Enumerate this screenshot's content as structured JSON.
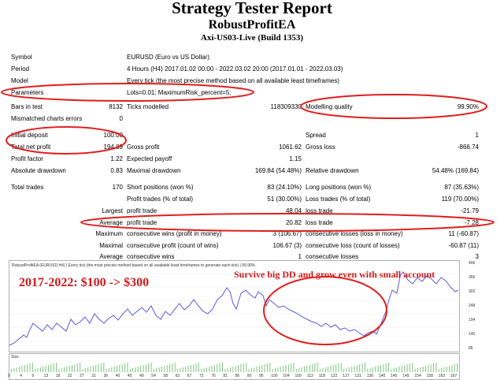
{
  "header": {
    "title": "Strategy Tester Report",
    "subtitle": "RobustProfitEA",
    "build": "Axi-US03-Live (Build 1353)"
  },
  "info": {
    "symbol_label": "Symbol",
    "symbol_value": "EURUSD (Euro vs US Dollar)",
    "period_label": "Period",
    "period_value": "4 Hours (H4) 2017.01.02 00:00 - 2022.03.02 20:00 (2017.01.01 - 2022.03.03)",
    "model_label": "Model",
    "model_value": "Every tick (the most precise method based on all available least timeframes)",
    "parameters_label": "Parameters",
    "parameters_value": "Lots=0.01; MaximumRisk_percent=5;"
  },
  "stats": {
    "bars_label": "Bars in test",
    "bars_value": "8132",
    "ticks_label": "Ticks modelled",
    "ticks_value": "118309330",
    "quality_label": "Modelling quality",
    "quality_value": "99.90%",
    "mismatch_label": "Mismatched charts errors",
    "mismatch_value": "0",
    "deposit_label": "Initial deposit",
    "deposit_value": "100.00",
    "spread_label": "Spread",
    "spread_value": "1",
    "netprofit_label": "Total net profit",
    "netprofit_value": "194.89",
    "grossprofit_label": "Gross profit",
    "grossprofit_value": "1061.62",
    "grossloss_label": "Gross loss",
    "grossloss_value": "-866.74",
    "pf_label": "Profit factor",
    "pf_value": "1.22",
    "ep_label": "Expected payoff",
    "ep_value": "1.15",
    "absdd_label": "Absolute drawdown",
    "absdd_value": "0.83",
    "maxdd_label": "Maximal drawdown",
    "maxdd_value": "169.84 (54.48%)",
    "reldd_label": "Relative drawdown",
    "reldd_value": "54.48% (169.84)",
    "trades_label": "Total trades",
    "trades_value": "170",
    "short_label": "Short positions (won %)",
    "short_value": "83 (24.10%)",
    "long_label": "Long positions (won %)",
    "long_value": "87 (35.63%)",
    "ptrades_label": "Profit trades (% of total)",
    "ptrades_value": "51 (30.00%)",
    "ltrades_label": "Loss trades (% of total)",
    "ltrades_value": "119 (70.00%)",
    "largest_label": "Largest",
    "lpt_label": "profit trade",
    "lpt_value": "48.04",
    "llt_label": "loss trade",
    "llt_value": "-21.79",
    "average_label": "Average",
    "apt_label": "profit trade",
    "apt_value": "20.82",
    "alt_label": "loss trade",
    "alt_value": "-7.28",
    "maximum_label": "Maximum",
    "mcw_label": "consecutive wins (profit in money)",
    "mcw_value": "3 (106.67)",
    "mcl_label": "consecutive losses (loss in money)",
    "mcl_value": "11 (-60.87)",
    "maximal_label": "Maximal",
    "mcp_label": "consecutive profit (count of wins)",
    "mcp_value": "106.67 (3)",
    "mclc_label": "consecutive loss (count of losses)",
    "mclc_value": "-60.87 (11)",
    "avg2_label": "Average",
    "acw_label": "consecutive wins",
    "acw_value": "1",
    "acl_label": "consecutive losses",
    "acl_value": "3"
  },
  "chart": {
    "caption": "RobustProfitEA (EURUSD,H4) | Every tick (the most precise method based on all available least timeframes to generate each tick) | 99.90%",
    "annotation_left": "2017-2022: $100 -> $300",
    "annotation_right": "Survive big DD and grow even with small account",
    "size_label": "Size",
    "y_ticks": [
      "406",
      "356",
      "302",
      "248",
      "194",
      "140",
      "86"
    ],
    "x_ticks": [
      "0",
      "4",
      "9",
      "13",
      "18",
      "22",
      "27",
      "31",
      "36",
      "40",
      "45",
      "49",
      "54",
      "58",
      "63",
      "67",
      "72",
      "76",
      "81",
      "86",
      "90",
      "95",
      "100",
      "104",
      "109",
      "113",
      "118",
      "122",
      "127",
      "131",
      "136",
      "140",
      "145",
      "149",
      "154",
      "158",
      "163",
      "167"
    ],
    "line_color": "#5a5adb",
    "annotation_color": "#d11a1a"
  }
}
